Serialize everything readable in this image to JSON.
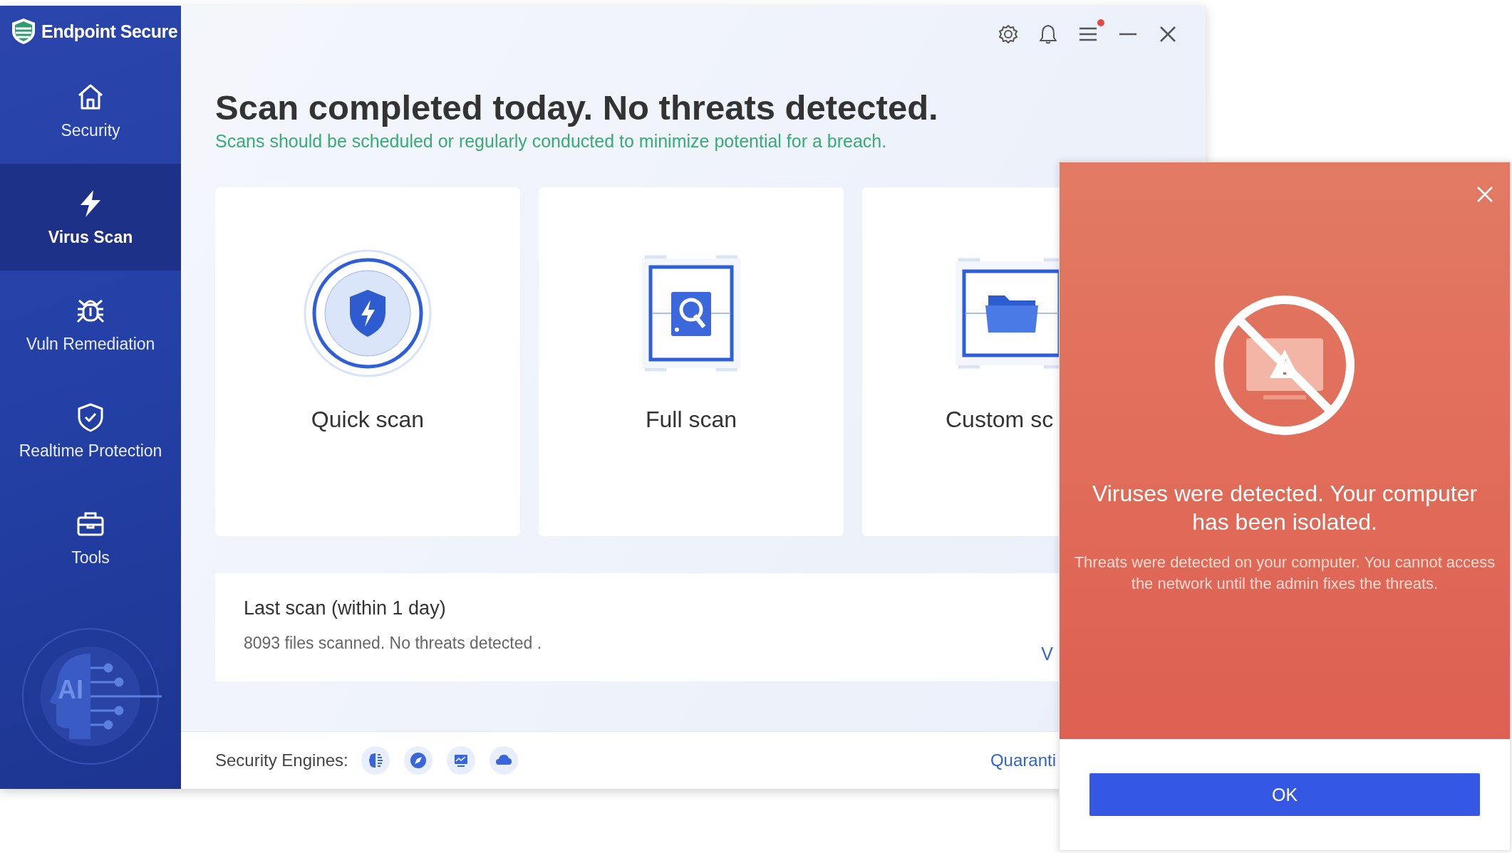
{
  "app": {
    "title": "Endpoint Secure"
  },
  "window_controls": {
    "menu_notification": true
  },
  "sidebar": {
    "items": [
      {
        "label": "Security",
        "selected": false
      },
      {
        "label": "Virus Scan",
        "selected": true
      },
      {
        "label": "Vuln Remediation",
        "selected": false
      },
      {
        "label": "Realtime Protection",
        "selected": false
      },
      {
        "label": "Tools",
        "selected": false
      }
    ],
    "ai_badge": "AI"
  },
  "header": {
    "title": "Scan completed today. No threats detected.",
    "subtitle": "Scans should be scheduled or regularly conducted to minimize potential for a breach."
  },
  "scan_options": [
    {
      "label": "Quick scan"
    },
    {
      "label": "Full scan"
    },
    {
      "label": "Custom sc"
    }
  ],
  "last_scan": {
    "title": "Last scan (within 1 day)",
    "detail": "8093 files scanned. No threats detected .",
    "link": "V"
  },
  "footer": {
    "engines_label": "Security Engines:",
    "link": "Quaranti"
  },
  "dialog": {
    "title": "Viruses were detected. Your computer has been isolated.",
    "message": "Threats were detected on your computer. You cannot access the network until the admin fixes the threats.",
    "button": "OK"
  }
}
